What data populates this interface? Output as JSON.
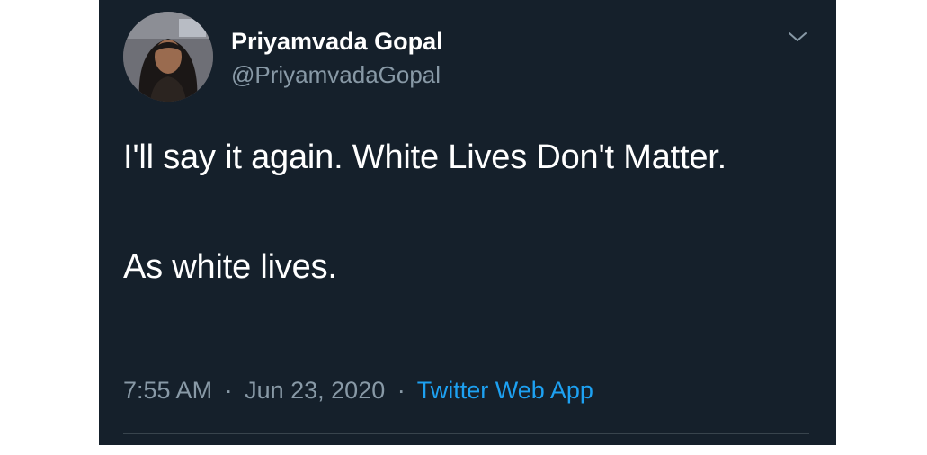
{
  "tweet": {
    "author": {
      "display_name": "Priyamvada Gopal",
      "handle": "@PriyamvadaGopal",
      "avatar_icon": "profile-photo"
    },
    "menu_icon": "chevron-down-icon",
    "text": {
      "line_1": "I'll say it again. White Lives Don't Matter.",
      "line_2": "As white lives."
    },
    "meta": {
      "time": "7:55 AM",
      "separator_1": "·",
      "date": "Jun 23, 2020",
      "separator_2": "·",
      "source": "Twitter Web App"
    }
  },
  "colors": {
    "card_background": "#15202b",
    "primary_text": "#ffffff",
    "secondary_text": "#8899a6",
    "link": "#1da1f2",
    "divider": "#38444d"
  }
}
